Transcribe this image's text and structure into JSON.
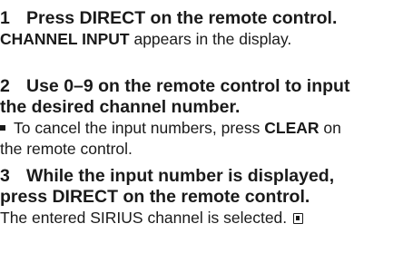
{
  "steps": [
    {
      "number": "1",
      "heading_lines": [
        "Press DIRECT on the remote control."
      ],
      "body": {
        "bold_prefix": "CHANNEL INPUT",
        "text": " appears in the display."
      }
    },
    {
      "number": "2",
      "heading_lines": [
        "Use 0–9 on the remote control to input",
        "the desired channel number."
      ],
      "note": {
        "line1_text": "To cancel the input numbers, press ",
        "line1_bold": "CLEAR",
        "line1_tail": " on",
        "line2_text": "the remote control."
      }
    },
    {
      "number": "3",
      "heading_lines": [
        "While the input number is displayed,",
        "press DIRECT on the remote control."
      ],
      "body": {
        "text": "The entered SIRIUS channel is selected."
      },
      "end_icon": "end-of-section-icon"
    }
  ]
}
